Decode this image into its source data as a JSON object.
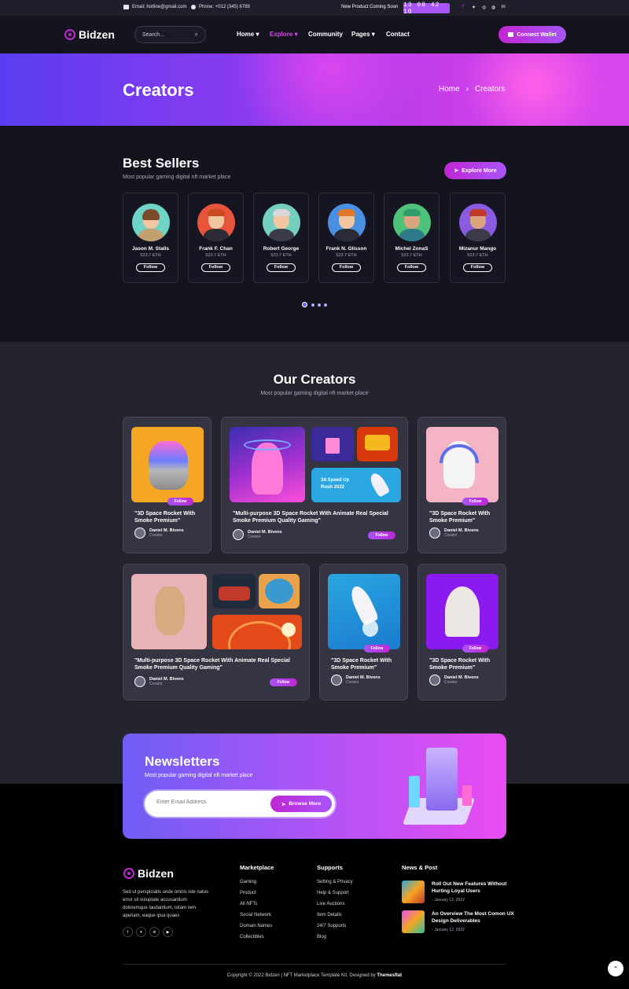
{
  "topbar": {
    "email": "Email: hotline@gmail.com",
    "phone": "Phone: +012 (345) 6789",
    "coming_soon": "New Product Coming Soon",
    "countdown": "13 08 42 10",
    "social": [
      "facebook-icon",
      "twitter-icon",
      "instagram-icon",
      "dribbble-icon",
      "linkedin-icon"
    ]
  },
  "header": {
    "logo": "Bidzen",
    "search_placeholder": "Search...",
    "nav": [
      "Home",
      "Explore",
      "Community",
      "Pages",
      "Contact"
    ],
    "wallet_label": "Connect Wallet"
  },
  "hero": {
    "title": "Creators",
    "breadcrumb": [
      "Home",
      "Creators"
    ]
  },
  "best": {
    "title": "Best Sellers",
    "subtitle": "Most popular gaming digital nft market place",
    "explore_label": "Explore More",
    "follow_label": "Follow",
    "sellers": [
      {
        "name": "Jason M. Stalls",
        "eth": "523.7 ETH"
      },
      {
        "name": "Frank F. Chan",
        "eth": "523.7 ETH"
      },
      {
        "name": "Robert George",
        "eth": "523.7 ETH"
      },
      {
        "name": "Frank N. Glisson",
        "eth": "523.7 ETH"
      },
      {
        "name": "Michel ZonaS",
        "eth": "523.7 ETH"
      },
      {
        "name": "Mizanur Mango",
        "eth": "523.7 ETH"
      }
    ]
  },
  "creators": {
    "title": "Our Creators",
    "subtitle": "Most popular gaming digital nft market place",
    "follow_label": "Follow",
    "author": "Daniel M. Bivens",
    "role": "Creator",
    "card_title_short": "\"3D Space Rocket With Smoke Premium\"",
    "card_title_long": "\"Multi-purpose 3D Space Rocket With Animate Real Special Smoke Premium Quality Gaming\"",
    "promo_text": "3d Speed Up Rush 2022"
  },
  "newsletter": {
    "title": "Newsletters",
    "subtitle": "Most popular gaming digital nft market place",
    "placeholder": "Enter Email Address",
    "button": "Browse More"
  },
  "footer": {
    "logo": "Bidzen",
    "about": "Sed ut perspiciatis unde omnis iste natus error sit voluptate accusantium doloremque laudantium, totam rem aperiam, eaque ipsa quaes",
    "marketplace": {
      "title": "Marketplace",
      "links": [
        "Gaming",
        "Product",
        "All NFTs",
        "Social Network",
        "Domain Names",
        "Collectibles"
      ]
    },
    "supports": {
      "title": "Supports",
      "links": [
        "Setting & Privacy",
        "Help & Support",
        "Live Auctions",
        "Item Details",
        "24/7 Supports",
        "Blog"
      ]
    },
    "news": {
      "title": "News & Post",
      "posts": [
        {
          "title": "Roll Out New Features Without Hurting Loyal Users",
          "date": "January 12, 2022"
        },
        {
          "title": "An Overview The Most Comon UX Design Deliverables",
          "date": "January 12, 2022"
        }
      ]
    },
    "copyright": "Copyright © 2022 Bidzen | NFT Marketplace Template Kit. Designed by",
    "designer": "Themesflat"
  }
}
